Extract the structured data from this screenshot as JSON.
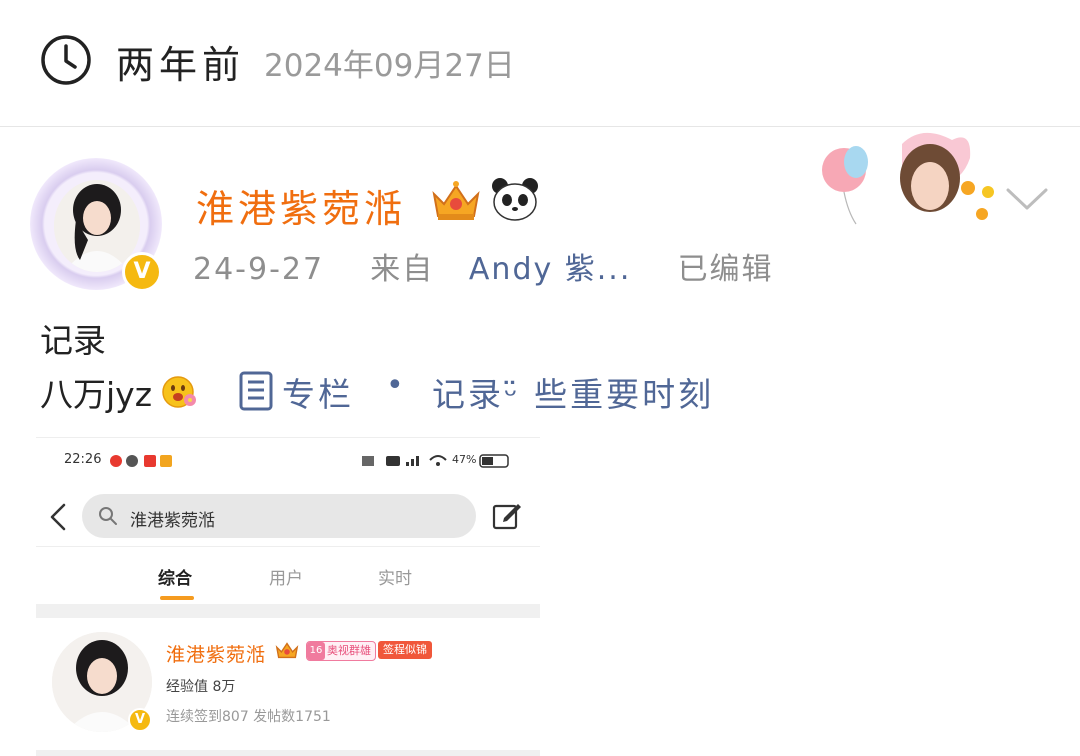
{
  "header": {
    "relative_time": "两年前",
    "date": "2024年09月27日",
    "clock_icon": "clock-icon"
  },
  "post": {
    "author": "淮港紫菀湉",
    "verified_mark": "V",
    "meta_time": "24-9-27",
    "meta_from": "来自",
    "meta_source": "Andy 紫...",
    "meta_edited": "已编辑",
    "text_line1": "记录",
    "text_line2": "八万jyz",
    "column_label": "专栏",
    "column_dot": "•",
    "column_title": "记录ᵕ̈ 些重要时刻"
  },
  "screenshot": {
    "status_time": "22:26",
    "status_battery": "47%",
    "search_query": "淮港紫菀湉",
    "tabs": [
      {
        "label": "综合",
        "active": true
      },
      {
        "label": "用户",
        "active": false
      },
      {
        "label": "实时",
        "active": false
      }
    ],
    "user": {
      "name": "淮港紫菀湉",
      "level": "16",
      "badge1": "奥视群雄",
      "badge2": "签程似锦",
      "exp": "经验值  8万",
      "stats": "连续签到807    发帖数1751",
      "verified_mark": "V"
    }
  },
  "colors": {
    "username": "#f06e0f",
    "link": "#506796",
    "muted": "#8e8e8e",
    "verified": "#f5b911"
  }
}
